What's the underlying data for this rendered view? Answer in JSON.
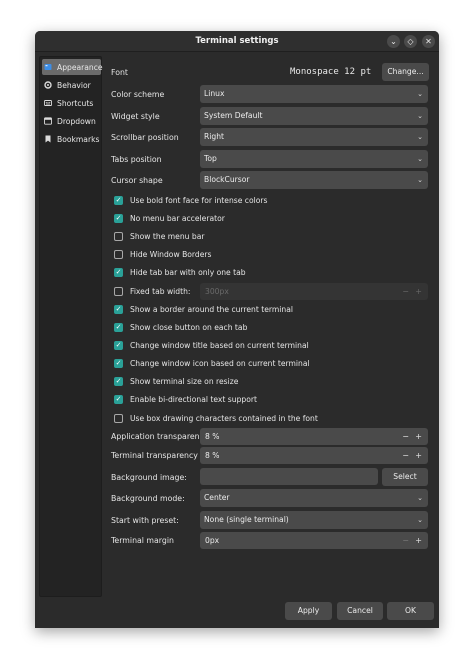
{
  "window": {
    "title": "Terminal settings"
  },
  "sidebar": {
    "items": [
      {
        "label": "Appearance",
        "icon": "appearance-icon",
        "active": true
      },
      {
        "label": "Behavior",
        "icon": "behavior-icon"
      },
      {
        "label": "Shortcuts",
        "icon": "keyboard-icon"
      },
      {
        "label": "Dropdown",
        "icon": "dropdown-icon"
      },
      {
        "label": "Bookmarks",
        "icon": "bookmark-icon"
      }
    ]
  },
  "font": {
    "label": "Font",
    "value": "Monospace 12 pt",
    "change_label": "Change..."
  },
  "combos": {
    "color_scheme": {
      "label": "Color scheme",
      "value": "Linux"
    },
    "widget_style": {
      "label": "Widget style",
      "value": "System Default"
    },
    "scrollbar_position": {
      "label": "Scrollbar position",
      "value": "Right"
    },
    "tabs_position": {
      "label": "Tabs position",
      "value": "Top"
    },
    "cursor_shape": {
      "label": "Cursor shape",
      "value": "BlockCursor"
    }
  },
  "checkboxes": [
    {
      "label": "Use bold font face for intense colors",
      "checked": true
    },
    {
      "label": "No menu bar accelerator",
      "checked": true
    },
    {
      "label": "Show the menu bar",
      "checked": false
    },
    {
      "label": "Hide Window Borders",
      "checked": false
    },
    {
      "label": "Hide tab bar with only one tab",
      "checked": true
    },
    {
      "label": "Fixed tab width:",
      "checked": false
    },
    {
      "label": "Show a border around the current terminal",
      "checked": true
    },
    {
      "label": "Show close button on each tab",
      "checked": true
    },
    {
      "label": "Change window title based on current terminal",
      "checked": true
    },
    {
      "label": "Change window icon based on current terminal",
      "checked": true
    },
    {
      "label": "Show terminal size on resize",
      "checked": true
    },
    {
      "label": "Enable bi-directional text support",
      "checked": true
    },
    {
      "label": "Use box drawing characters contained in the font",
      "checked": false
    }
  ],
  "fixed_tab_width": {
    "value": "300px"
  },
  "app_transparency": {
    "label": "Application transparency",
    "value": "8 %"
  },
  "terminal_transparency": {
    "label": "Terminal transparency",
    "value": "8 %"
  },
  "background_image": {
    "label": "Background image:",
    "value": "",
    "select_label": "Select"
  },
  "background_mode": {
    "label": "Background mode:",
    "value": "Center"
  },
  "start_preset": {
    "label": "Start with preset:",
    "value": "None (single terminal)"
  },
  "terminal_margin": {
    "label": "Terminal margin",
    "value": "0px"
  },
  "buttons": {
    "apply": "Apply",
    "cancel": "Cancel",
    "ok": "OK"
  },
  "spin_symbols": {
    "minus": "−",
    "plus": "+"
  },
  "glyphs": {
    "chevron": "⌄",
    "minimize": "⌄",
    "restore": "◇",
    "close": "✕",
    "check": "✓"
  },
  "colors": {
    "accent": "#2aa198",
    "window_bg": "#2b2b2b",
    "control_bg": "#4a4a4a"
  }
}
